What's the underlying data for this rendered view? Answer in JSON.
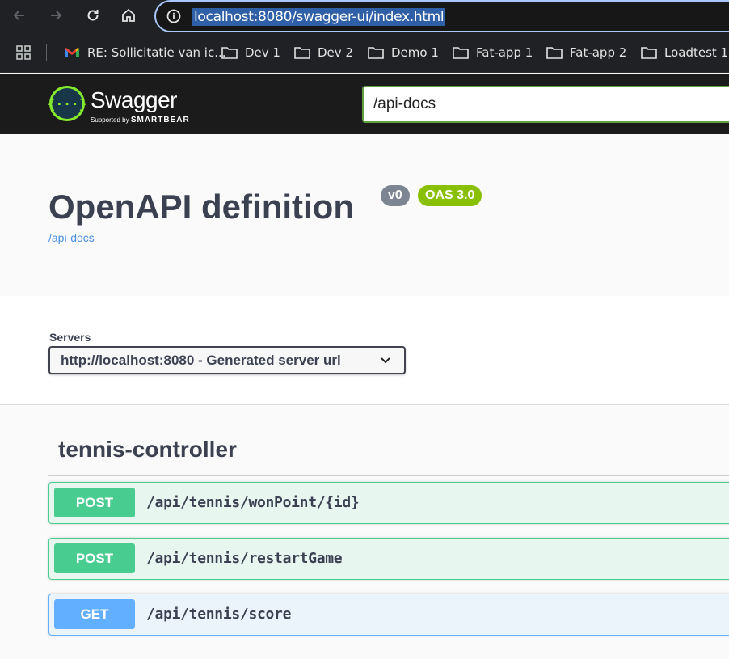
{
  "browser": {
    "url": "localhost:8080/swagger-ui/index.html",
    "bookmarks": [
      {
        "label": "RE: Sollicitatie van ic...",
        "icon": "gmail-icon"
      },
      {
        "label": "Dev 1",
        "icon": "folder-icon"
      },
      {
        "label": "Dev 2",
        "icon": "folder-icon"
      },
      {
        "label": "Demo 1",
        "icon": "folder-icon"
      },
      {
        "label": "Fat-app 1",
        "icon": "folder-icon"
      },
      {
        "label": "Fat-app 2",
        "icon": "folder-icon"
      },
      {
        "label": "Loadtest 1",
        "icon": "folder-icon"
      }
    ]
  },
  "topbar": {
    "logo_text": "Swagger",
    "logo_sub_prefix": "Supported by",
    "logo_sub_brand": "SMARTBEAR",
    "spec_url": "/api-docs"
  },
  "info": {
    "title": "OpenAPI definition",
    "version_badge": "v0",
    "oas_badge": "OAS 3.0",
    "link": "/api-docs"
  },
  "servers": {
    "label": "Servers",
    "selected": "http://localhost:8080 - Generated server url"
  },
  "tag": {
    "name": "tennis-controller",
    "operations": [
      {
        "method": "POST",
        "path": "/api/tennis/wonPoint/{id}"
      },
      {
        "method": "POST",
        "path": "/api/tennis/restartGame"
      },
      {
        "method": "GET",
        "path": "/api/tennis/score"
      }
    ]
  },
  "colors": {
    "post": "#49cc90",
    "get": "#61affe",
    "accent": "#89bf04"
  }
}
